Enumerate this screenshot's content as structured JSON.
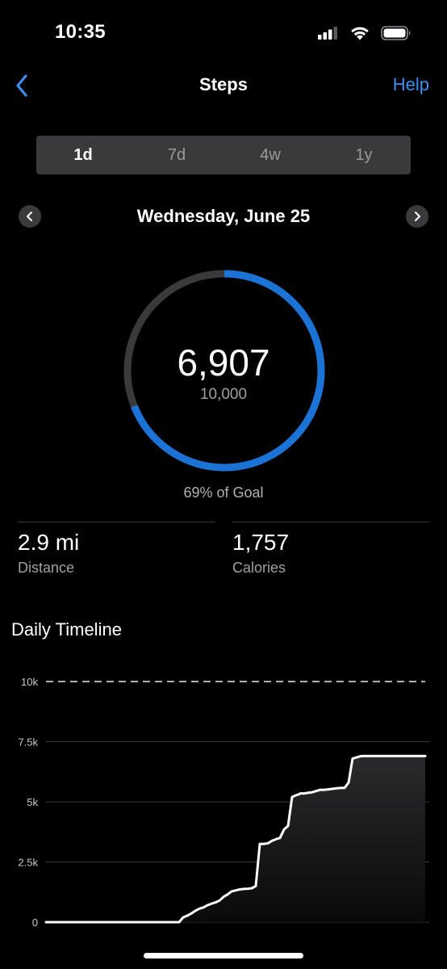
{
  "status_bar": {
    "time": "10:35",
    "icons": [
      "signal-icon",
      "wifi-icon",
      "battery-icon"
    ]
  },
  "header": {
    "back_icon": "chevron-left-icon",
    "title": "Steps",
    "help_label": "Help",
    "accent_color": "#3d8ef0"
  },
  "period_tabs": [
    {
      "label": "1d",
      "active": true
    },
    {
      "label": "7d",
      "active": false
    },
    {
      "label": "4w",
      "active": false
    },
    {
      "label": "1y",
      "active": false
    }
  ],
  "date_nav": {
    "date": "Wednesday, June 25",
    "prev_icon": "chevron-left-icon",
    "next_icon": "chevron-right-icon"
  },
  "progress": {
    "steps": "6,907",
    "goal": "10,000",
    "percent_label": "69% of Goal",
    "fraction": 0.69,
    "ring_color": "#1c73d6",
    "track_color": "#3a3a3c"
  },
  "stats": [
    {
      "value": "2.9 mi",
      "label": "Distance"
    },
    {
      "value": "1,757",
      "label": "Calories"
    }
  ],
  "timeline": {
    "title": "Daily Timeline"
  },
  "chart_data": {
    "type": "area",
    "title": "Daily Timeline",
    "xlabel": "",
    "ylabel": "",
    "y_tick_labels": [
      "10k",
      "7.5k",
      "5k",
      "2.5k",
      "0"
    ],
    "y_ticks": [
      10000,
      7500,
      5000,
      2500,
      0
    ],
    "ylim": [
      0,
      10000
    ],
    "goal_line": 10000,
    "grid": true,
    "series": [
      {
        "x": [
          0,
          33,
          34,
          35,
          36,
          37,
          38,
          39,
          40,
          41,
          42,
          43,
          44,
          45,
          46,
          47,
          48,
          49,
          50,
          51,
          52,
          53,
          54,
          55,
          56,
          57,
          58,
          59,
          60,
          61,
          62,
          62.5,
          63,
          64,
          65,
          66,
          67,
          68,
          69,
          70,
          71,
          72,
          73,
          74,
          75,
          76,
          77,
          78,
          79,
          80,
          81,
          82,
          83,
          84,
          85,
          86,
          87,
          88,
          89,
          90,
          91,
          92,
          93,
          94
        ],
        "values": [
          0,
          0,
          200,
          270,
          360,
          470,
          560,
          610,
          700,
          770,
          820,
          900,
          1050,
          1150,
          1280,
          1320,
          1360,
          1380,
          1390,
          1410,
          1500,
          3250,
          3250,
          3280,
          3380,
          3450,
          3500,
          3850,
          4000,
          5200,
          5280,
          5300,
          5350,
          5350,
          5380,
          5400,
          5450,
          5500,
          5500,
          5520,
          5540,
          5560,
          5580,
          5580,
          5800,
          6800,
          6850,
          6900,
          6907,
          6907,
          6907,
          6907,
          6907,
          6907,
          6907,
          6907,
          6907,
          6907,
          6907,
          6907,
          6907,
          6907,
          6907,
          6907
        ]
      }
    ],
    "line_color": "#ffffff"
  }
}
